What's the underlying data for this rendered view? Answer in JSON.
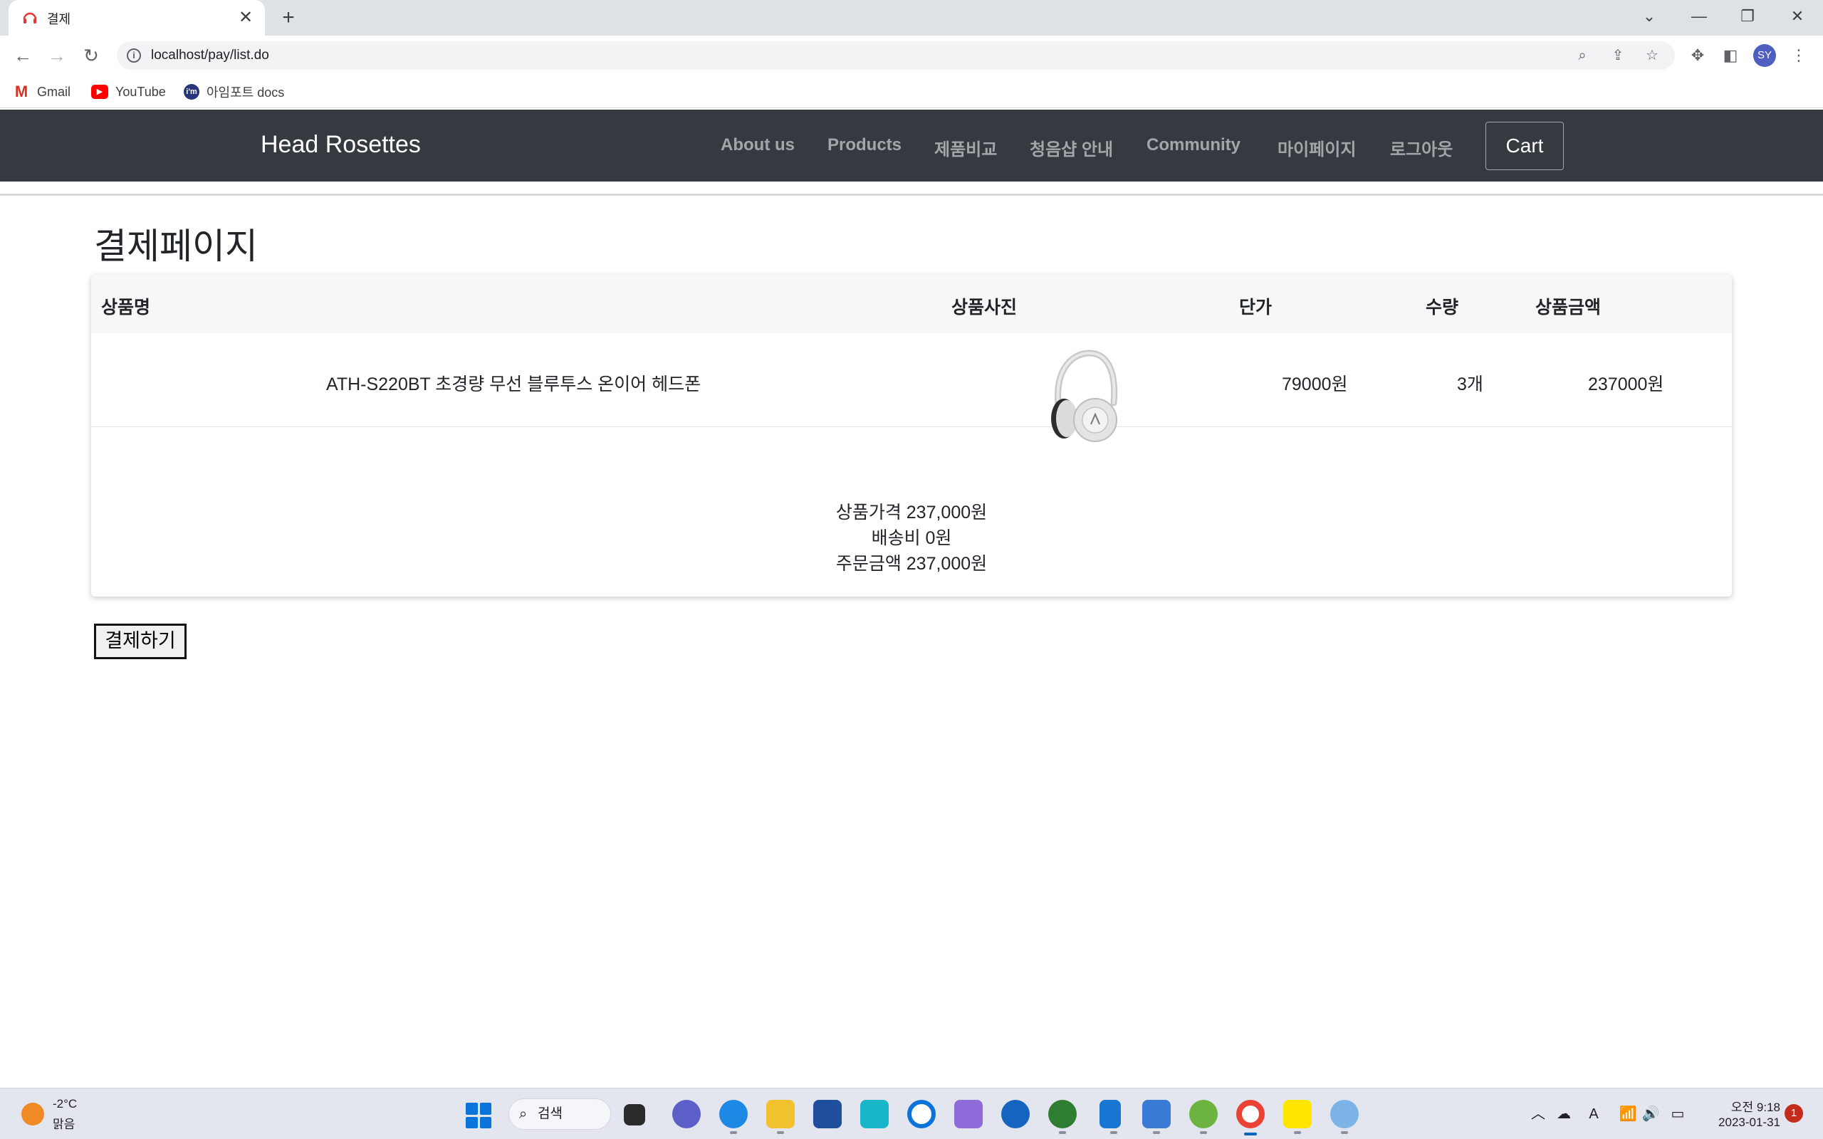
{
  "browser": {
    "tab_title": "결제",
    "tab_close_glyph": "✕",
    "new_tab_glyph": "+",
    "url": "localhost/pay/list.do",
    "profile_initials": "SY",
    "window_controls": {
      "dropdown": "⌄",
      "minimize": "—",
      "restore": "❐",
      "close": "✕"
    },
    "nav": {
      "back": "←",
      "forward": "→",
      "reload": "↻"
    },
    "info_glyph": "i"
  },
  "bookmarks": [
    {
      "label": "Gmail",
      "icon": "gmail-icon"
    },
    {
      "label": "YouTube",
      "icon": "youtube-icon"
    },
    {
      "label": "아임포트 docs",
      "icon": "iamport-icon"
    }
  ],
  "site": {
    "brand": "Head Rosettes",
    "nav_links": [
      "About us",
      "Products",
      "제품비교",
      "청음샵 안내",
      "Community",
      "마이페이지",
      "로그아웃"
    ],
    "cart_label": "Cart",
    "nav_bg": "#343a40"
  },
  "page": {
    "title": "결제페이지",
    "table": {
      "headers": [
        "상품명",
        "상품사진",
        "단가",
        "수량",
        "상품금액"
      ],
      "rows": [
        {
          "name": "ATH-S220BT 초경량 무선 블루투스 온이어 헤드폰",
          "image": "headphones-image",
          "unit_price": "79000원",
          "quantity": "3개",
          "amount": "237000원"
        }
      ]
    },
    "summary": {
      "product_price": "상품가격 237,000원",
      "shipping": "배송비 0원",
      "order_total": "주문금액 237,000원"
    },
    "pay_button": "결제하기"
  },
  "taskbar": {
    "weather_temp": "-2°C",
    "weather_desc": "맑음",
    "search_label": "검색",
    "time": "오전 9:18",
    "date": "2023-01-31",
    "notification_count": "1",
    "tray_glyphs": {
      "chevron": "︿",
      "cloud": "☁",
      "ime": "A",
      "wifi": "📶",
      "volume": "🔊",
      "battery": "▭"
    }
  }
}
